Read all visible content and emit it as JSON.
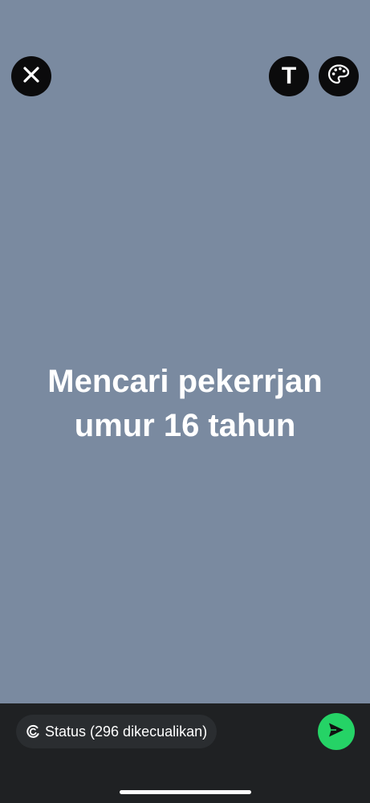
{
  "toolbar": {
    "close_icon": "close-icon",
    "text_icon": "text-icon",
    "text_glyph": "T",
    "palette_icon": "palette-icon"
  },
  "status": {
    "line1": "Mencari pekerrjan",
    "line2": "umur 16 tahun",
    "background_color": "#7a8aa0",
    "text_color": "#ffffff"
  },
  "bottom": {
    "audience_label": "Status (296 dikecualikan)",
    "audience_icon": "status-ring-icon",
    "send_icon": "send-icon",
    "send_color": "#25d366"
  }
}
